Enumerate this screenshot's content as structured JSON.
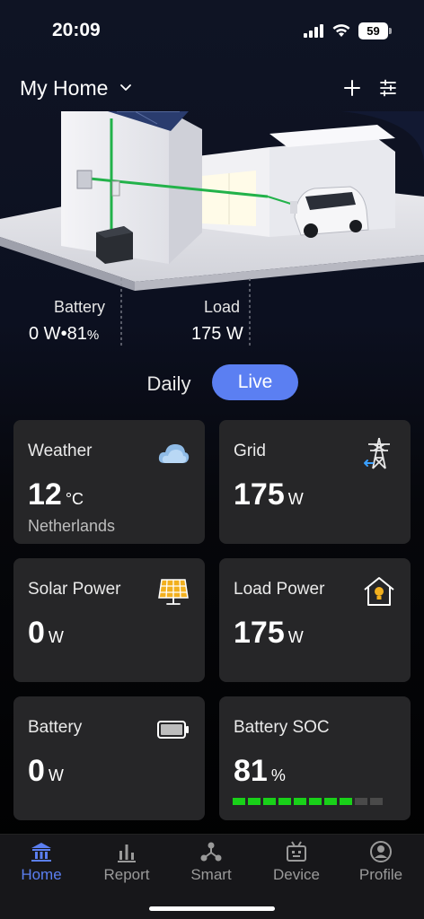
{
  "status": {
    "time": "20:09",
    "battery": "59"
  },
  "header": {
    "title": "My Home"
  },
  "flows": {
    "battery": {
      "label": "Battery",
      "value": "0 W",
      "soc": "81",
      "soc_unit": "%"
    },
    "load": {
      "label": "Load",
      "value": "175 W"
    }
  },
  "tabs": {
    "daily": "Daily",
    "live": "Live"
  },
  "cards": {
    "weather": {
      "title": "Weather",
      "value": "12",
      "unit": "°C",
      "location": "Netherlands"
    },
    "grid": {
      "title": "Grid",
      "value": "175",
      "unit": "W"
    },
    "solar": {
      "title": "Solar Power",
      "value": "0",
      "unit": "W"
    },
    "load": {
      "title": "Load Power",
      "value": "175",
      "unit": "W"
    },
    "battery": {
      "title": "Battery",
      "value": "0",
      "unit": "W"
    },
    "soc": {
      "title": "Battery SOC",
      "value": "81",
      "unit": "%",
      "segments_on": 8,
      "segments_total": 10
    }
  },
  "nav": {
    "items": [
      {
        "label": "Home",
        "icon": "home-icon"
      },
      {
        "label": "Report",
        "icon": "report-icon"
      },
      {
        "label": "Smart",
        "icon": "smart-icon"
      },
      {
        "label": "Device",
        "icon": "device-icon"
      },
      {
        "label": "Profile",
        "icon": "profile-icon"
      }
    ],
    "active": "Home"
  },
  "colors": {
    "accent": "#5b7ff2",
    "card": "#262628",
    "soc_on": "#19d119",
    "soc_off": "#4a4a4a"
  }
}
